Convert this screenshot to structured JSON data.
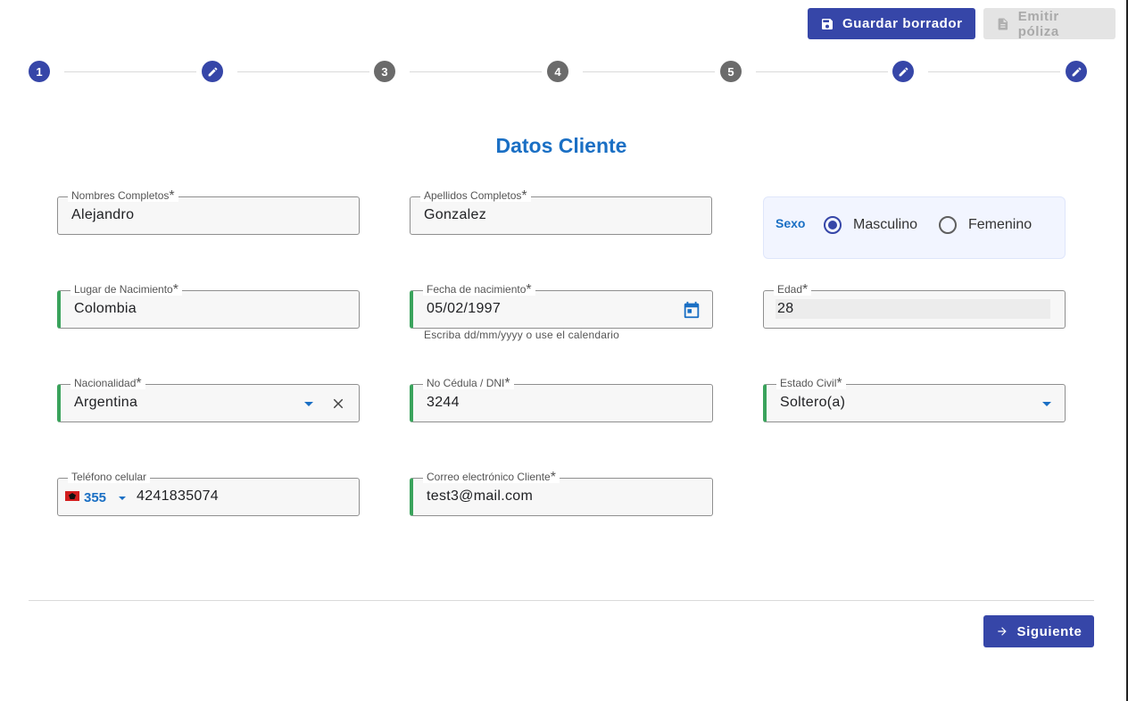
{
  "toolbar": {
    "save_draft_label": "Guardar borrador",
    "issue_policy_label": "Emitir póliza"
  },
  "stepper": {
    "steps": [
      {
        "label": "1",
        "state": "active"
      },
      {
        "label": "",
        "state": "edit"
      },
      {
        "label": "3",
        "state": "todo"
      },
      {
        "label": "4",
        "state": "todo"
      },
      {
        "label": "5",
        "state": "todo"
      },
      {
        "label": "",
        "state": "edit"
      },
      {
        "label": "",
        "state": "edit"
      }
    ]
  },
  "form": {
    "title": "Datos Cliente",
    "nombres": {
      "label": "Nombres Completos",
      "required": "*",
      "value": "Alejandro"
    },
    "apellidos": {
      "label": "Apellidos Completos",
      "required": "*",
      "value": "Gonzalez"
    },
    "sexo": {
      "label": "Sexo",
      "options": [
        "Masculino",
        "Femenino"
      ],
      "selected": "Masculino"
    },
    "lugar_nacimiento": {
      "label": "Lugar de Nacimiento",
      "required": "*",
      "value": "Colombia"
    },
    "fecha_nacimiento": {
      "label": "Fecha de nacimiento",
      "required": "*",
      "value": "05/02/1997",
      "hint": "Escriba dd/mm/yyyy o use el calendario"
    },
    "edad": {
      "label": "Edad",
      "required": "*",
      "value": "28"
    },
    "nacionalidad": {
      "label": "Nacionalidad",
      "required": "*",
      "value": "Argentina"
    },
    "cedula": {
      "label": "No Cédula / DNI",
      "required": "*",
      "value": "3244"
    },
    "estado_civil": {
      "label": "Estado Civil",
      "required": "*",
      "value": "Soltero(a)"
    },
    "telefono": {
      "label": "Teléfono celular",
      "dial_code": "355",
      "value": "4241835074"
    },
    "correo": {
      "label": "Correo electrónico Cliente",
      "required": "*",
      "value": "test3@mail.com"
    }
  },
  "footer": {
    "next_label": "Siguiente"
  },
  "colors": {
    "primary": "#3646a8",
    "title_blue": "#1a6fc4",
    "valid_green": "#3aa35c",
    "disabled_bg": "#e4e4e4"
  }
}
